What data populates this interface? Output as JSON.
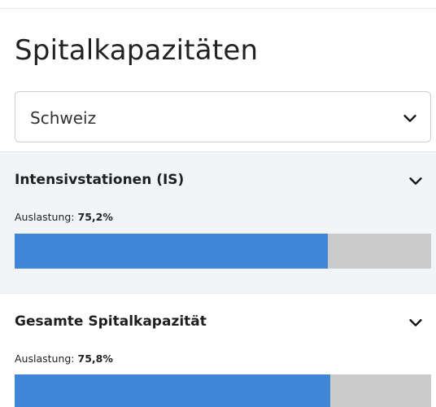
{
  "page": {
    "title": "Spitalkapazitäten"
  },
  "region_select": {
    "value": "Schweiz",
    "icon": "chevron-down-icon"
  },
  "sections": [
    {
      "title": "Intensivstationen (IS)",
      "utilization_label": "Auslastung:",
      "utilization_value": "75,2%",
      "utilization_fraction": 0.752,
      "icon": "chevron-down-icon",
      "colors": {
        "fill": "#3f86d6",
        "track": "#cbcbcb",
        "background": "#f1f5f8"
      }
    },
    {
      "title": "Gesamte Spitalkapazität",
      "utilization_label": "Auslastung:",
      "utilization_value": "75,8%",
      "utilization_fraction": 0.758,
      "icon": "chevron-down-icon",
      "colors": {
        "fill": "#3f86d6",
        "track": "#cbcbcb",
        "background": "#ffffff"
      }
    }
  ]
}
